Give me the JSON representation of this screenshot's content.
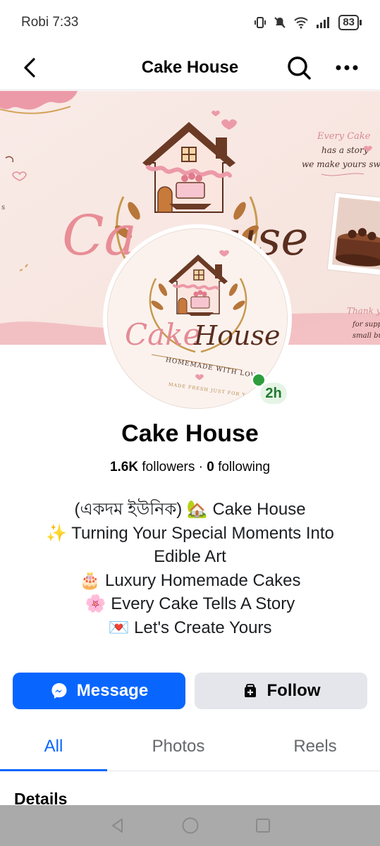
{
  "status_bar": {
    "carrier_time": "Robi 7:33",
    "battery": "83"
  },
  "header": {
    "title": "Cake House"
  },
  "cover": {
    "logo_text_a": "Ca",
    "logo_text_b": "use",
    "tagline_1": "Every Cake",
    "tagline_2": "has a story",
    "tagline_3": "we make yours swe",
    "thanks_1": "Thank y",
    "thanks_2": "for suppo",
    "thanks_3": "small bus"
  },
  "avatar": {
    "logo_word_1": "Cake",
    "logo_word_2": "House",
    "ribbon": "HOMEMADE WITH LOVE",
    "arc_text": "MADE FRESH JUST FOR YOU"
  },
  "profile": {
    "name": "Cake House",
    "active_badge": "2h",
    "followers_count": "1.6K",
    "followers_label": " followers · ",
    "following_count": "0",
    "following_label": " following"
  },
  "bio": [
    "(একদম ইউনিক) 🏡 Cake House",
    "✨ Turning Your Special Moments Into",
    "Edible Art",
    "🎂 Luxury Homemade Cakes",
    "🌸 Every Cake Tells A Story",
    "💌 Let's Create Yours"
  ],
  "actions": {
    "message_label": "Message",
    "follow_label": "Follow"
  },
  "tabs": {
    "all": "All",
    "photos": "Photos",
    "reels": "Reels"
  },
  "details_heading": "Details",
  "colors": {
    "accent": "#0866ff",
    "secondary_button": "#e4e6eb",
    "active_green": "#2e9e3c",
    "brand_pink": "#e48b94",
    "brand_brown": "#5a2e1e"
  }
}
